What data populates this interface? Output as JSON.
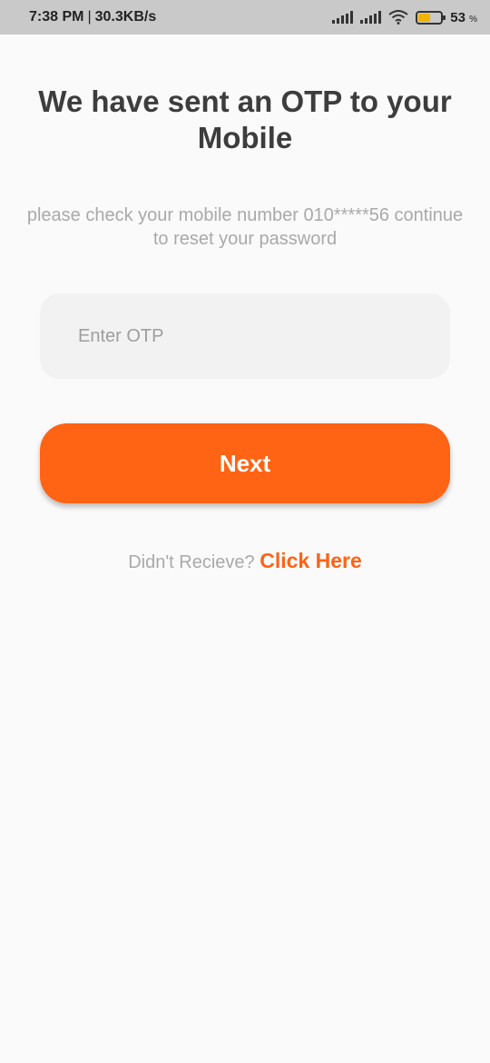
{
  "status_bar": {
    "time": "7:38 PM",
    "separator": "|",
    "network_speed": "30.3KB/s",
    "battery_percent": "53",
    "battery_unit": "%",
    "battery_level": 0.53,
    "icons": [
      "signal-icon",
      "signal-icon",
      "wifi-icon",
      "battery-icon"
    ]
  },
  "main": {
    "title": "We have sent an OTP to your Mobile",
    "subtitle": "please check your mobile number 010*****56 continue to reset your password",
    "otp_input": {
      "placeholder": "Enter OTP",
      "value": ""
    },
    "next_label": "Next",
    "resend_text": "Didn't Recieve?",
    "resend_link": "Click Here"
  },
  "colors": {
    "accent": "#ff6314",
    "title": "#3d3d3d",
    "muted": "#a9a9a9",
    "input_bg": "#f2f2f2",
    "background": "#fafafa"
  }
}
